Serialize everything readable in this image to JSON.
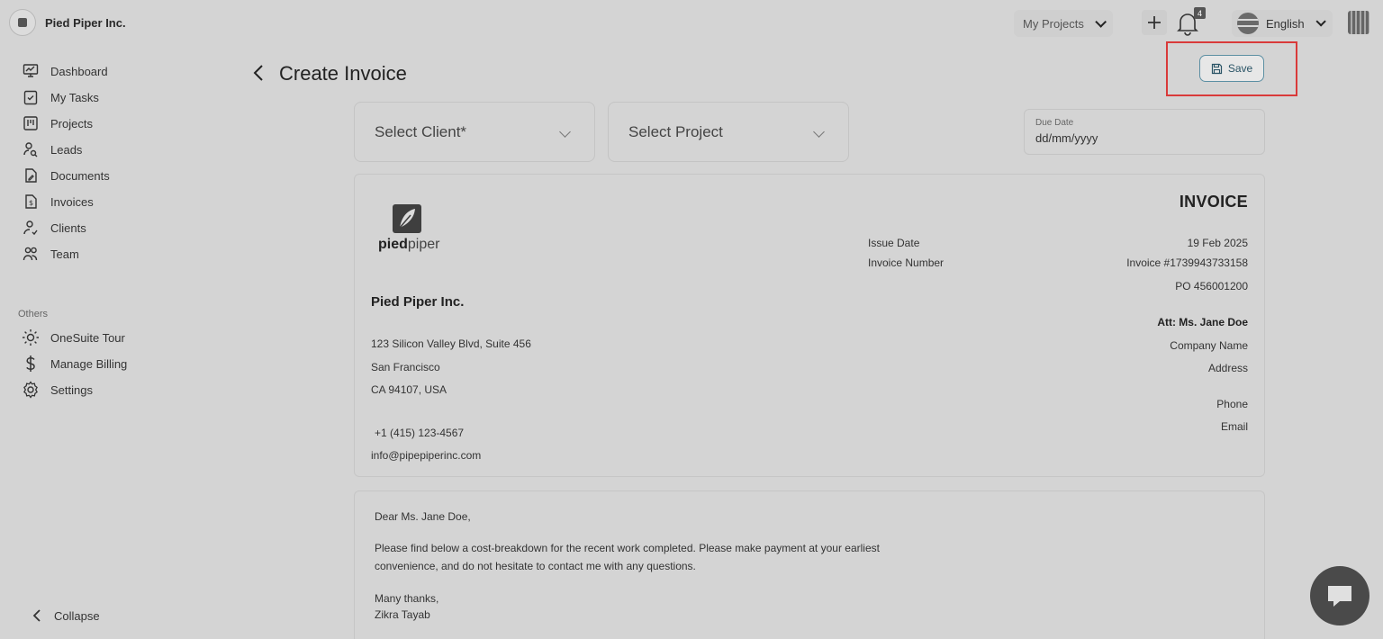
{
  "topbar": {
    "org_name": "Pied Piper Inc.",
    "projects_label": "My Projects",
    "notification_count": "4",
    "language": "English"
  },
  "sidebar": {
    "items": [
      {
        "label": "Dashboard",
        "icon": "dashboard-icon"
      },
      {
        "label": "My Tasks",
        "icon": "tasks-icon"
      },
      {
        "label": "Projects",
        "icon": "projects-icon"
      },
      {
        "label": "Leads",
        "icon": "leads-icon"
      },
      {
        "label": "Documents",
        "icon": "documents-icon"
      },
      {
        "label": "Invoices",
        "icon": "invoices-icon"
      },
      {
        "label": "Clients",
        "icon": "clients-icon"
      },
      {
        "label": "Team",
        "icon": "team-icon"
      }
    ],
    "others_label": "Others",
    "others": [
      {
        "label": "OneSuite Tour",
        "icon": "sun-icon"
      },
      {
        "label": "Manage Billing",
        "icon": "dollar-icon"
      },
      {
        "label": "Settings",
        "icon": "gear-icon"
      }
    ],
    "collapse_label": "Collapse"
  },
  "header": {
    "title": "Create Invoice",
    "save_label": "Save"
  },
  "form": {
    "client_placeholder": "Select Client*",
    "project_placeholder": "Select Project",
    "due_date_label": "Due Date",
    "due_date_value": "dd/mm/yyyy"
  },
  "invoice": {
    "logo_text_bold": "pied",
    "logo_text_light": "piper",
    "heading": "INVOICE",
    "issue_date_label": "Issue Date",
    "issue_date_value": "19 Feb 2025",
    "invoice_number_label": "Invoice Number",
    "invoice_number_value": "Invoice #1739943733158",
    "po_value": "PO 456001200",
    "sender": {
      "company": "Pied Piper Inc.",
      "address1": "123 Silicon Valley Blvd, Suite 456",
      "city": "San Francisco",
      "state_zip": "CA 94107, USA",
      "phone": "+1 (415) 123-4567",
      "email": "info@pipepiperinc.com"
    },
    "recipient": {
      "attention": "Att: Ms. Jane Doe",
      "company": "Company Name",
      "address": "Address",
      "phone": "Phone",
      "email": "Email"
    }
  },
  "letter": {
    "greeting": "Dear  Ms. Jane Doe,",
    "body_line1": "Please find below a cost-breakdown for the recent work completed. Please make payment at your earliest",
    "body_line2": "convenience, and do not hesitate to contact me with any questions.",
    "closing": "Many thanks,",
    "signature": "Zikra Tayab"
  }
}
